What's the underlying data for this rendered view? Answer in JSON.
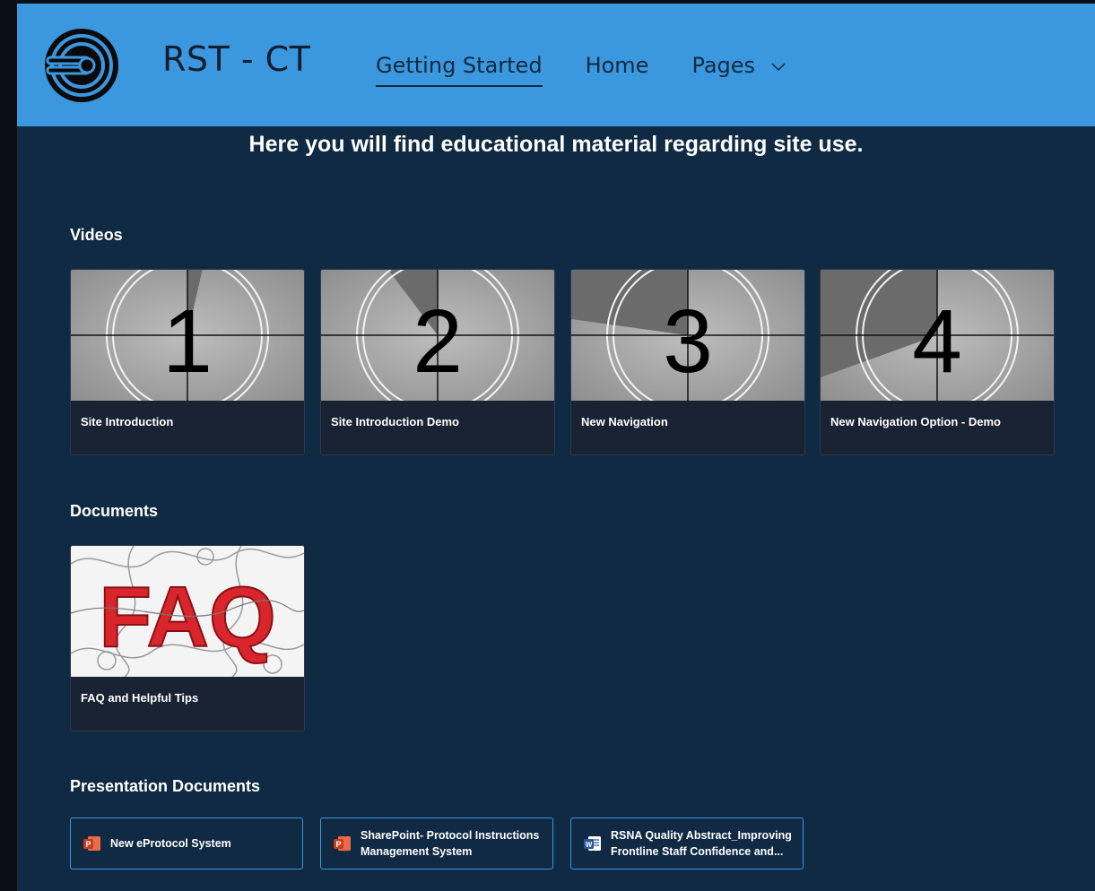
{
  "header": {
    "site_title": "RST - CT",
    "nav": [
      {
        "label": "Getting Started"
      },
      {
        "label": "Home"
      },
      {
        "label": "Pages"
      }
    ]
  },
  "main": {
    "subtitle": "Here you will find educational material regarding site use.",
    "videos": {
      "title": "Videos",
      "items": [
        {
          "number": "1",
          "label": "Site Introduction"
        },
        {
          "number": "2",
          "label": "Site Introduction Demo"
        },
        {
          "number": "3",
          "label": "New Navigation"
        },
        {
          "number": "4",
          "label": "New Navigation Option - Demo"
        }
      ]
    },
    "documents": {
      "title": "Documents",
      "items": [
        {
          "thumb_text": "FAQ",
          "label": "FAQ and Helpful Tips"
        }
      ]
    },
    "presentations": {
      "title": "Presentation Documents",
      "items": [
        {
          "icon": "powerpoint-icon",
          "label": "New eProtocol System"
        },
        {
          "icon": "powerpoint-icon",
          "label": "SharePoint- Protocol Instructions Management System"
        },
        {
          "icon": "word-icon",
          "label": "RSNA Quality Abstract_Improving Frontline Staff Confidence and..."
        }
      ]
    }
  },
  "colors": {
    "header_bg": "#3b97de",
    "page_bg": "#102a43",
    "card_bg": "#1a2333",
    "accent": "#3b97de"
  }
}
